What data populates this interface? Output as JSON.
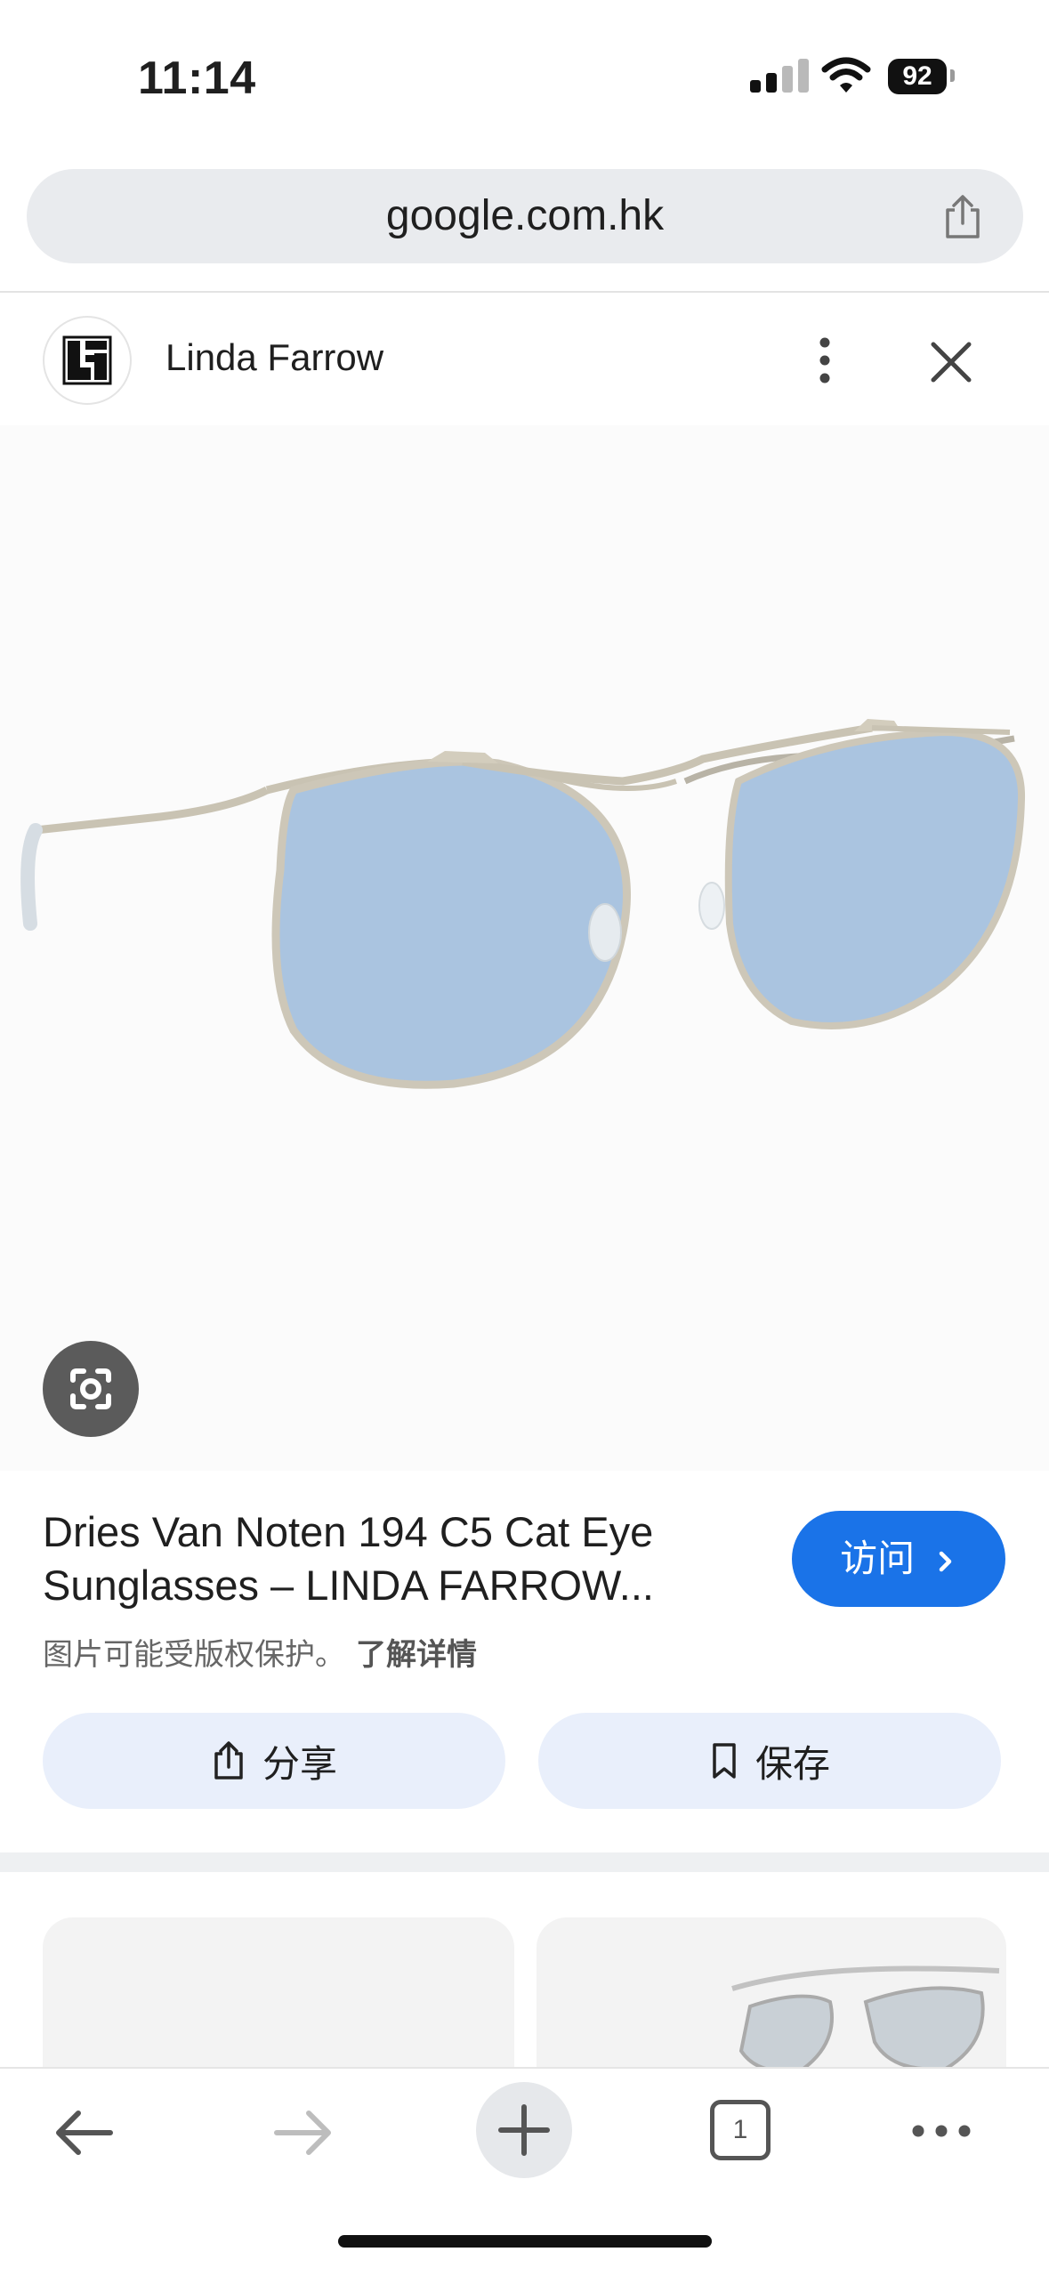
{
  "status_bar": {
    "time": "11:14",
    "battery": "92"
  },
  "browser": {
    "url": "google.com.hk"
  },
  "source": {
    "name": "Linda Farrow",
    "logo_text": "LF"
  },
  "result": {
    "title": "Dries Van Noten 194 C5 Cat Eye Sunglasses – LINDA FARROW...",
    "visit_label": "访问",
    "copyright_text": "图片可能受版权保护。",
    "learn_more": "了解详情",
    "share_label": "分享",
    "save_label": "保存"
  },
  "toolbar": {
    "tab_count": "1"
  },
  "colors": {
    "accent": "#1a73e8",
    "pill_bg": "#e9effb",
    "lens": "#aac4e0",
    "frame": "#c9c3b3"
  },
  "icons": [
    "signal-icon",
    "wifi-icon",
    "battery-icon",
    "share-icon",
    "more-vert-icon",
    "close-icon",
    "lens-icon",
    "chevron-right-icon",
    "bookmark-icon",
    "back-arrow-icon",
    "forward-arrow-icon",
    "plus-icon",
    "tabs-icon",
    "more-horiz-icon"
  ]
}
